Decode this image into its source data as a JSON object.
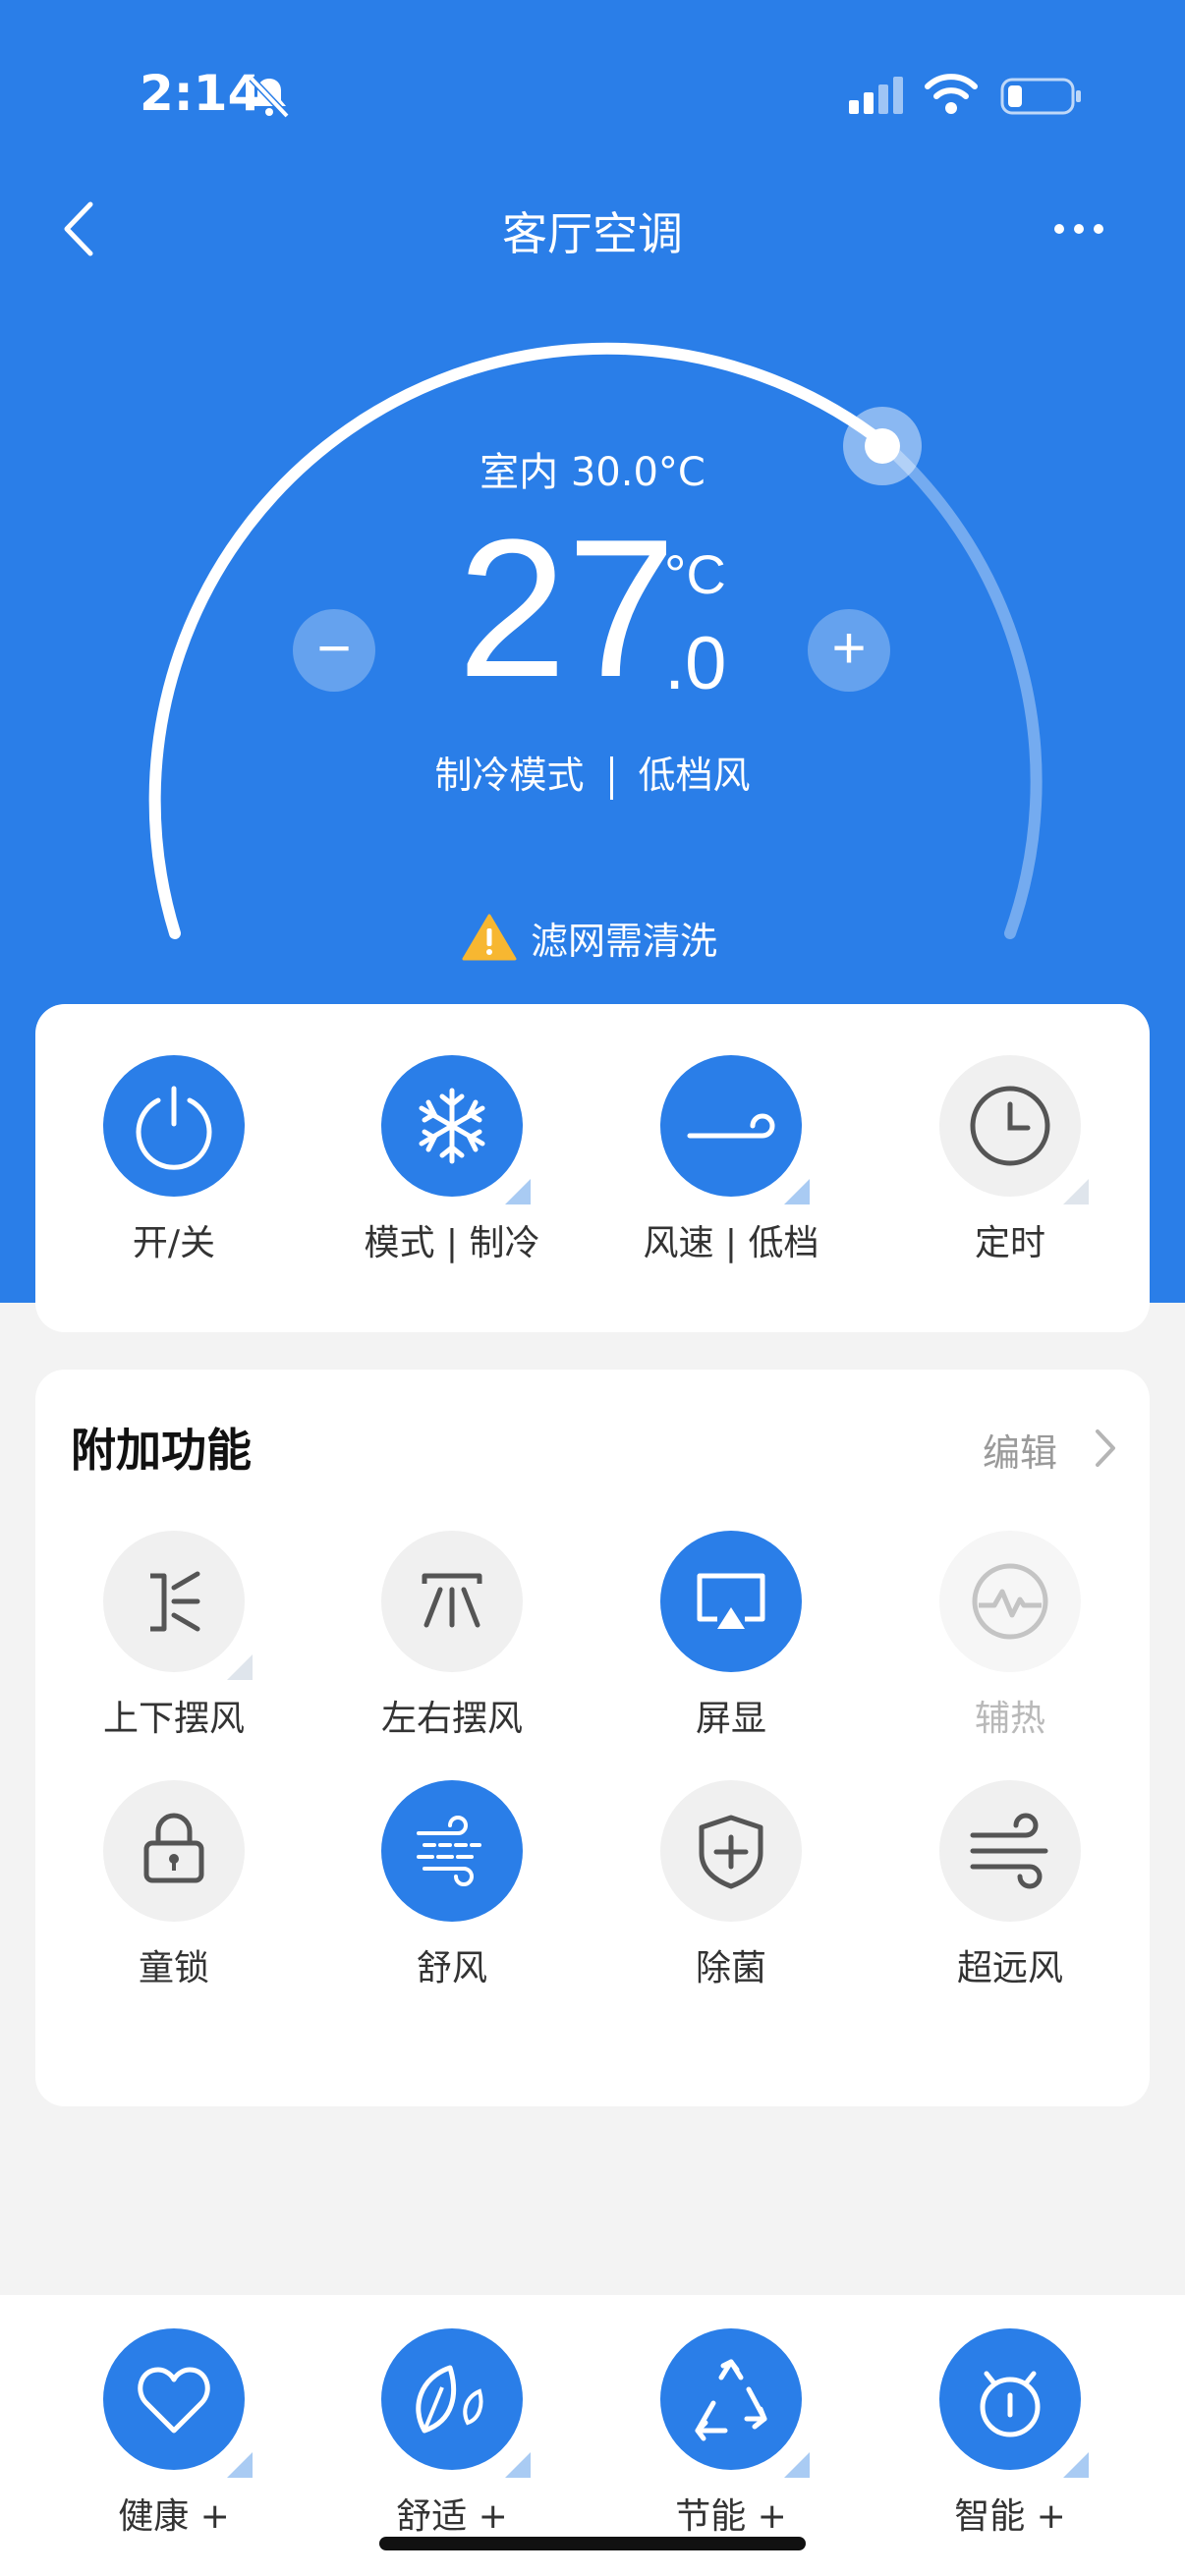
{
  "status_bar": {
    "time": "2:14"
  },
  "header": {
    "title": "客厅空调"
  },
  "thermostat": {
    "indoor_label": "室内 30.0°C",
    "set_temp_integer": "27",
    "set_temp_unit": "°C",
    "set_temp_decimal": ".0",
    "minus_label": "−",
    "plus_label": "+",
    "mode": "制冷模式",
    "fan": "低档风",
    "alert": "滤网需清洗"
  },
  "controls": [
    {
      "label": "开/关"
    },
    {
      "label": "模式 | 制冷"
    },
    {
      "label": "风速 | 低档"
    },
    {
      "label": "定时"
    }
  ],
  "extras": {
    "title": "附加功能",
    "edit_label": "编辑",
    "items": [
      {
        "label": "上下摆风"
      },
      {
        "label": "左右摆风"
      },
      {
        "label": "屏显"
      },
      {
        "label": "辅热"
      },
      {
        "label": "童锁"
      },
      {
        "label": "舒风"
      },
      {
        "label": "除菌"
      },
      {
        "label": "超远风"
      }
    ]
  },
  "bottom_nav": [
    {
      "label": "健康 +"
    },
    {
      "label": "舒适 +"
    },
    {
      "label": "节能 +"
    },
    {
      "label": "智能 +"
    }
  ],
  "colors": {
    "primary": "#2a7ee8",
    "card": "#ffffff",
    "background": "#f3f3f3",
    "inactive_circle": "#f0f0f0",
    "warning": "#f7b731"
  }
}
